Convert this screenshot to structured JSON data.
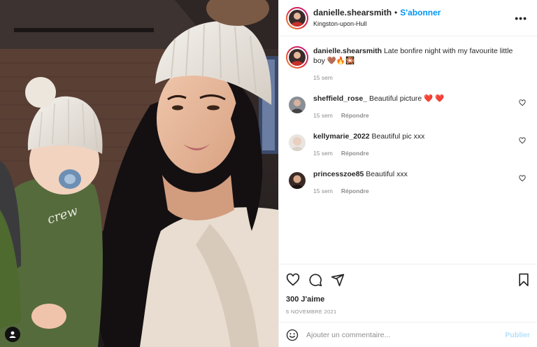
{
  "post": {
    "username": "danielle.shearsmith",
    "separator": "•",
    "follow_label": "S'abonner",
    "location": "Kingston-upon-Hull",
    "more_label": "•••",
    "caption": {
      "username": "danielle.shearsmith",
      "text": "Late bonfire night with my favourite little boy 🤎🔥🎇",
      "time": "15 sem"
    },
    "comments": [
      {
        "username": "sheffield_rose_",
        "text": "Beautiful picture ❤️ ❤️",
        "time": "15 sem",
        "reply": "Répondre"
      },
      {
        "username": "kellymarie_2022",
        "text": "Beautiful pic xxx",
        "time": "15 sem",
        "reply": "Répondre"
      },
      {
        "username": "princesszoe85",
        "text": "Beautiful xxx",
        "time": "15 sem",
        "reply": "Répondre"
      }
    ],
    "likes": "300 J'aime",
    "date": "6 NOVEMBRE 2021",
    "comment_placeholder": "Ajouter un commentaire...",
    "publish_label": "Publier",
    "photo_text": "crew"
  },
  "icons": {
    "like": "heart-icon",
    "comment": "comment-icon",
    "share": "send-icon",
    "save": "bookmark-icon",
    "emoji": "emoji-icon",
    "tagged": "user-tag-icon"
  },
  "colors": {
    "accent": "#0095f6",
    "publish_disabled": "#b2dffc",
    "muted": "#8e8e8e"
  }
}
